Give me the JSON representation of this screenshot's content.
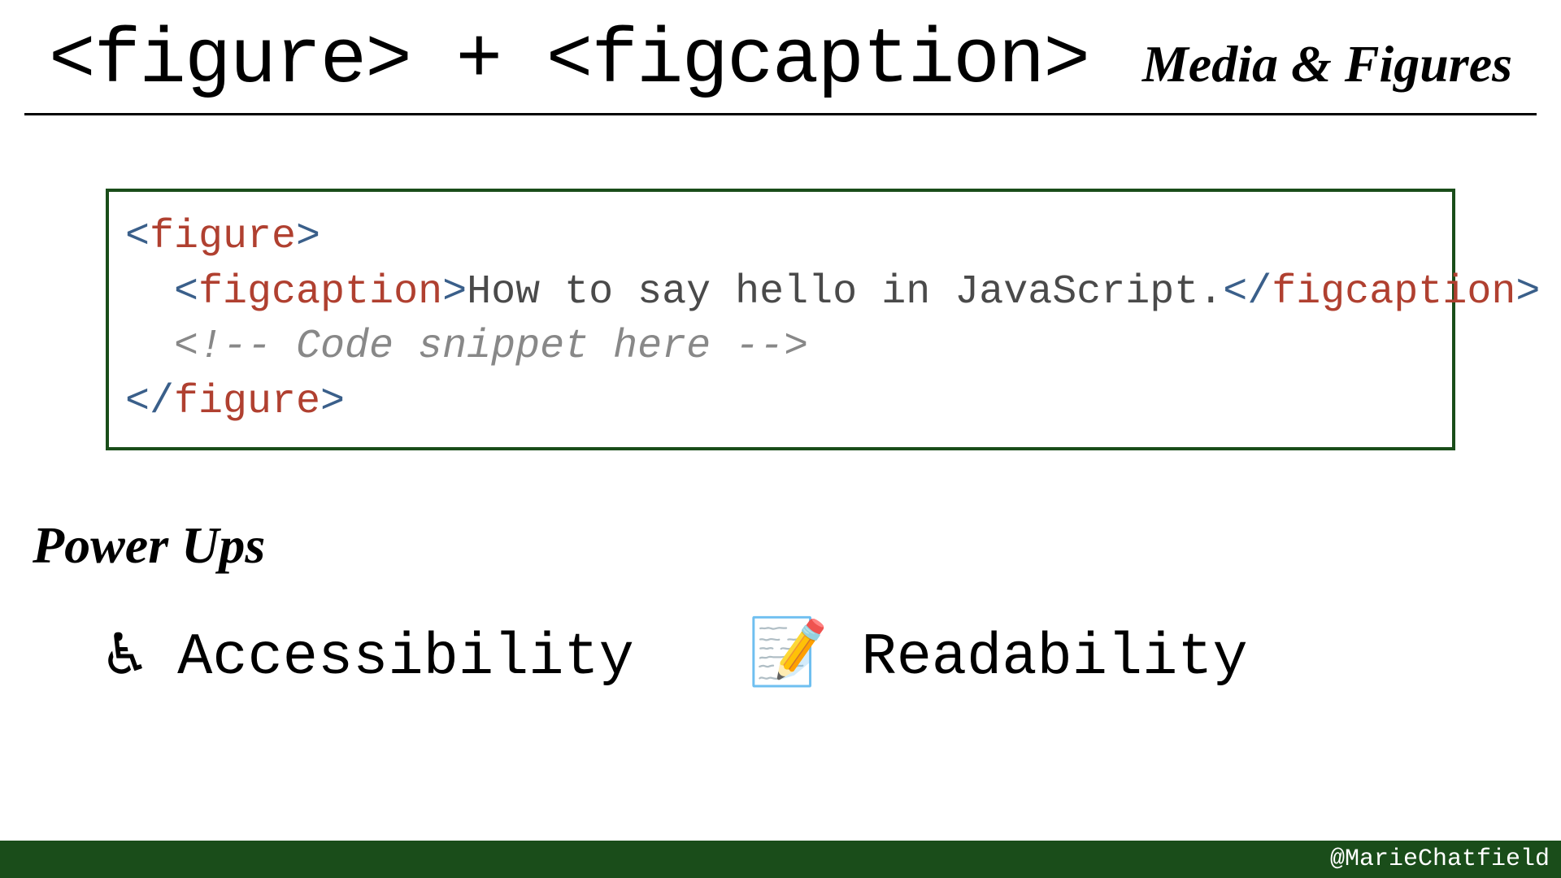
{
  "header": {
    "title": "<figure> + <figcaption>",
    "subtitle": "Media & Figures"
  },
  "code": {
    "l1_open_bracket": "<",
    "l1_tag": "figure",
    "l1_close_bracket": ">",
    "l2_indent": "  ",
    "l2_open_bracket": "<",
    "l2_tag": "figcaption",
    "l2_close_bracket": ">",
    "l2_text": "How to say hello in JavaScript.",
    "l2_open_bracket2": "</",
    "l2_tag2": "figcaption",
    "l2_close_bracket2": ">",
    "l3_indent": "  ",
    "l3_comment": "<!-- Code snippet here -->",
    "l4_open_bracket": "</",
    "l4_tag": "figure",
    "l4_close_bracket": ">"
  },
  "powerups_heading": "Power Ups",
  "powerups": [
    {
      "icon": "♿",
      "label": "Accessibility"
    },
    {
      "icon": "📝",
      "label": "Readability"
    }
  ],
  "footer": {
    "handle": "@MarieChatfield"
  }
}
